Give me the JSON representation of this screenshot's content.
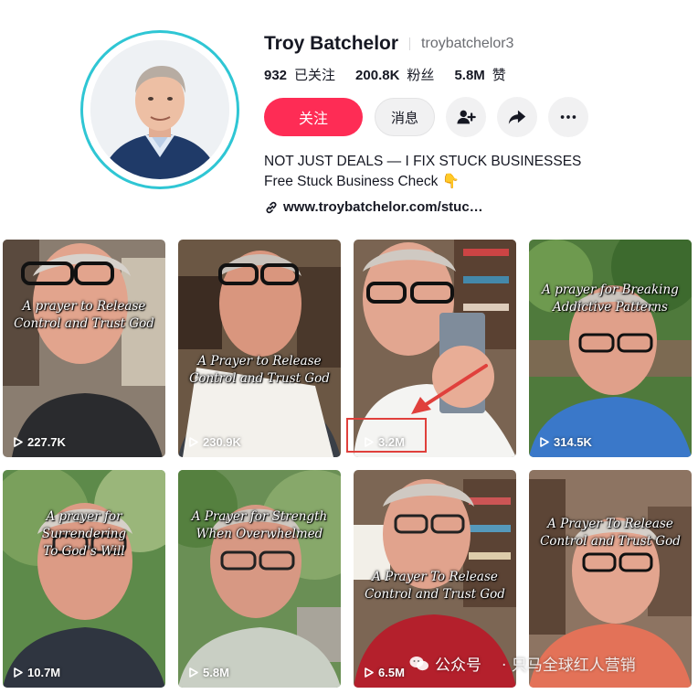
{
  "profile": {
    "display_name": "Troy Batchelor",
    "username": "troybatchelor3",
    "stats": [
      {
        "value": "932",
        "label": "已关注"
      },
      {
        "value": "200.8K",
        "label": "粉丝"
      },
      {
        "value": "5.8M",
        "label": "赞"
      }
    ],
    "buttons": {
      "follow": "关注",
      "message": "消息"
    },
    "bio_line1": "NOT JUST DEALS — I FIX STUCK BUSINESSES",
    "bio_line2": "Free Stuck Business Check 👇",
    "link": "www.troybatchelor.com/stuc…"
  },
  "icons": {
    "add_friend": "person-plus-icon",
    "share": "share-arrow-icon",
    "more": "more-dots-icon",
    "link": "link-icon",
    "play": "play-icon"
  },
  "colors": {
    "accent": "#fe2c55",
    "avatar_ring": "#2fc6d4",
    "highlight": "#e0403c"
  },
  "videos": [
    {
      "caption_line1": "A prayer to Release",
      "caption_line2": "Control and Trust God",
      "views": "227.7K"
    },
    {
      "caption_line1": "A Prayer to Release",
      "caption_line2": "Control and Trust God",
      "views": "230.9K"
    },
    {
      "caption_line1": "",
      "caption_line2": "",
      "views": "3.2M"
    },
    {
      "caption_line1": "A prayer for Breaking",
      "caption_line2": "Addictive Patterns",
      "views": "314.5K"
    },
    {
      "caption_line1": "A prayer for Surrendering",
      "caption_line2": "To God's Will",
      "views": "10.7M"
    },
    {
      "caption_line1": "A Prayer for Strength",
      "caption_line2": "When Overwhelmed",
      "views": "5.8M"
    },
    {
      "caption_line1": "A Prayer To Release",
      "caption_line2": "Control and Trust God",
      "views": "6.5M"
    },
    {
      "caption_line1": "A Prayer To Release",
      "caption_line2": "Control and Trust God",
      "views": ""
    }
  ],
  "watermark": {
    "source": "公众号",
    "account": "· 只马全球红人营销"
  }
}
